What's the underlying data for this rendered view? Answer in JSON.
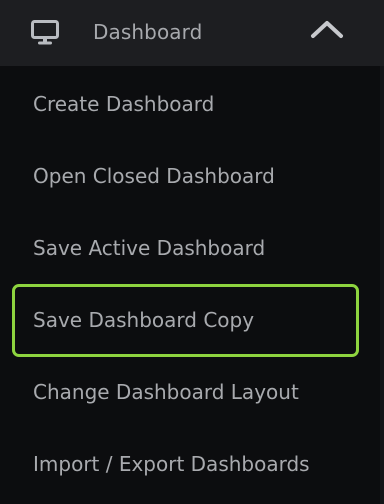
{
  "header": {
    "title": "Dashboard",
    "icon": "monitor-icon",
    "toggle_icon": "chevron-up-icon"
  },
  "menu": {
    "items": [
      {
        "label": "Create Dashboard"
      },
      {
        "label": "Open Closed Dashboard"
      },
      {
        "label": "Save Active Dashboard"
      },
      {
        "label": "Save Dashboard Copy",
        "selected": true
      },
      {
        "label": "Change Dashboard Layout"
      },
      {
        "label": "Import / Export Dashboards"
      }
    ]
  },
  "colors": {
    "background": "#0c0d0f",
    "header_background": "#1d1e21",
    "text": "#a8aaae",
    "focus_ring": "#8ed43f"
  }
}
